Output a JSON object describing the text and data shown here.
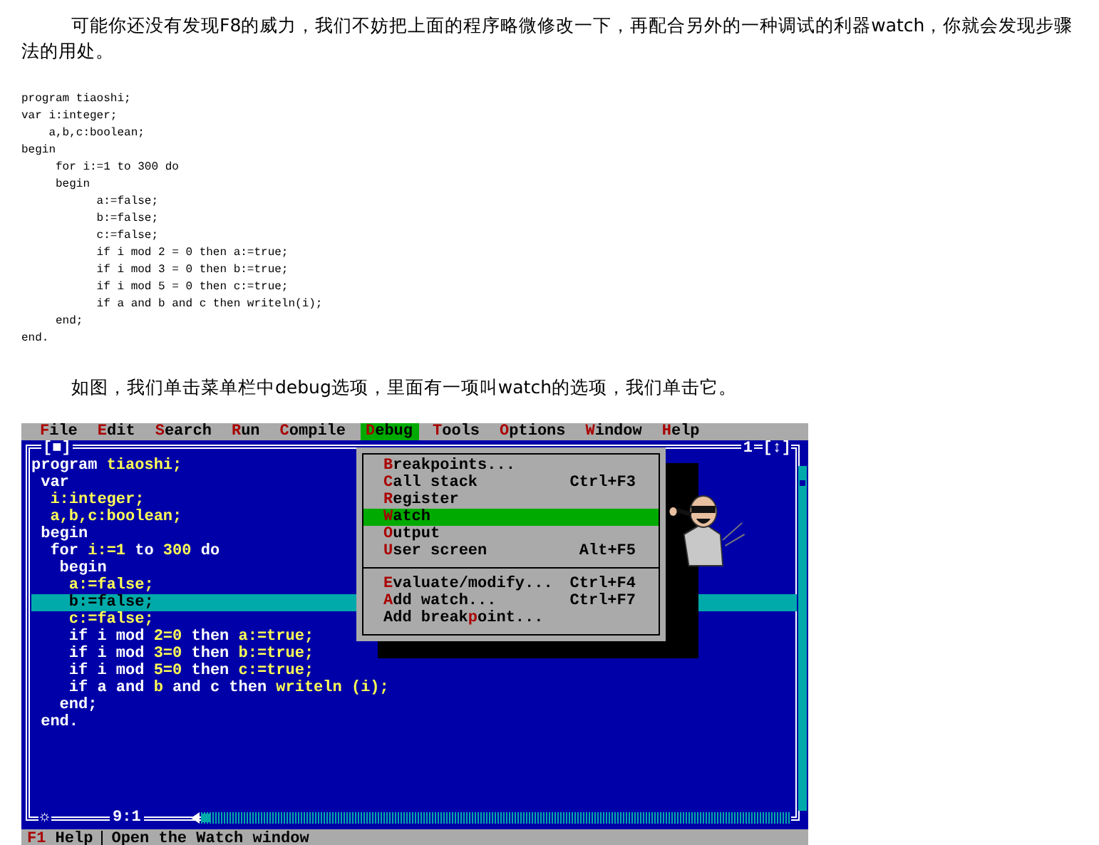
{
  "paragraphs": [
    "可能你还没有发现F8的威力，我们不妨把上面的程序略微修改一下，再配合另外的一种调试的利器watch，你就会发现步骤法的用处。"
  ],
  "code_listing": [
    "program tiaoshi;",
    "var i:integer;",
    "    a,b,c:boolean;",
    "begin",
    "     for i:=1 to 300 do",
    "     begin",
    "           a:=false;",
    "           b:=false;",
    "           c:=false;",
    "           if i mod 2 = 0 then a:=true;",
    "           if i mod 3 = 0 then b:=true;",
    "           if i mod 5 = 0 then c:=true;",
    "           if a and b and c then writeln(i);",
    "     end;",
    "end."
  ],
  "paragraph_2": "如图，我们单击菜单栏中debug选项，里面有一项叫watch的选项，我们单击它。",
  "ide": {
    "menu_bar": [
      {
        "hotkey": "F",
        "rest": "ile",
        "selected": false
      },
      {
        "hotkey": "E",
        "rest": "dit",
        "selected": false
      },
      {
        "hotkey": "S",
        "rest": "earch",
        "selected": false
      },
      {
        "hotkey": "R",
        "rest": "un",
        "selected": false
      },
      {
        "hotkey": "C",
        "rest": "ompile",
        "selected": false
      },
      {
        "hotkey": "D",
        "rest": "ebug",
        "selected": true
      },
      {
        "hotkey": "T",
        "rest": "ools",
        "selected": false
      },
      {
        "hotkey": "O",
        "rest": "ptions",
        "selected": false
      },
      {
        "hotkey": "W",
        "rest": "indow",
        "selected": false
      },
      {
        "hotkey": "H",
        "rest": "elp",
        "selected": false
      }
    ],
    "editor": {
      "close_box": "[■]",
      "window_number": "1",
      "zoom_box": "[↕]",
      "resize_glyph": "☼",
      "cursor_position": "9:1",
      "lines": [
        {
          "selected": false,
          "segments": [
            {
              "kind": "keyword",
              "text": "program"
            },
            {
              "kind": "text",
              "text": " tiaoshi;"
            }
          ]
        },
        {
          "selected": false,
          "segments": [
            {
              "kind": "keyword",
              "text": " var"
            }
          ]
        },
        {
          "selected": false,
          "segments": [
            {
              "kind": "text",
              "text": "  i:integer;"
            }
          ]
        },
        {
          "selected": false,
          "segments": [
            {
              "kind": "text",
              "text": "  a,b,c:boolean;"
            }
          ]
        },
        {
          "selected": false,
          "segments": [
            {
              "kind": "keyword",
              "text": " begin"
            }
          ]
        },
        {
          "selected": false,
          "segments": [
            {
              "kind": "keyword",
              "text": "  for"
            },
            {
              "kind": "text",
              "text": " i:=1 "
            },
            {
              "kind": "keyword",
              "text": "to"
            },
            {
              "kind": "text",
              "text": " 300 "
            },
            {
              "kind": "keyword",
              "text": "do"
            }
          ]
        },
        {
          "selected": false,
          "segments": [
            {
              "kind": "keyword",
              "text": "   begin"
            }
          ]
        },
        {
          "selected": false,
          "segments": [
            {
              "kind": "text",
              "text": "    a:=false;"
            }
          ]
        },
        {
          "selected": true,
          "segments": [
            {
              "kind": "text",
              "text": "    b:=false;"
            }
          ]
        },
        {
          "selected": false,
          "segments": [
            {
              "kind": "text",
              "text": "    c:=false;"
            }
          ]
        },
        {
          "selected": false,
          "segments": [
            {
              "kind": "keyword",
              "text": "    if i mod "
            },
            {
              "kind": "text",
              "text": "2=0"
            },
            {
              "kind": "keyword",
              "text": " then "
            },
            {
              "kind": "text",
              "text": "a:=true;"
            }
          ]
        },
        {
          "selected": false,
          "segments": [
            {
              "kind": "keyword",
              "text": "    if i mod "
            },
            {
              "kind": "text",
              "text": "3=0"
            },
            {
              "kind": "keyword",
              "text": " then "
            },
            {
              "kind": "text",
              "text": "b:=true;"
            }
          ]
        },
        {
          "selected": false,
          "segments": [
            {
              "kind": "keyword",
              "text": "    if i mod "
            },
            {
              "kind": "text",
              "text": "5=0"
            },
            {
              "kind": "keyword",
              "text": " then "
            },
            {
              "kind": "text",
              "text": "c:=true;"
            }
          ]
        },
        {
          "selected": false,
          "segments": [
            {
              "kind": "keyword",
              "text": "    if a and "
            },
            {
              "kind": "text",
              "text": "b"
            },
            {
              "kind": "keyword",
              "text": " and c then "
            },
            {
              "kind": "text",
              "text": "writeln (i);"
            }
          ]
        },
        {
          "selected": false,
          "segments": [
            {
              "kind": "keyword",
              "text": "   end;"
            }
          ]
        },
        {
          "selected": false,
          "segments": [
            {
              "kind": "keyword",
              "text": " end."
            }
          ]
        }
      ]
    },
    "debug_menu": [
      [
        {
          "hotkey": "B",
          "after": "reakpoints...",
          "selected": false
        },
        {
          "hotkey": "C",
          "after": "all stack",
          "shortcut": "Ctrl+F3",
          "selected": false
        },
        {
          "hotkey": "R",
          "after": "egister",
          "selected": false
        },
        {
          "hotkey": "W",
          "after": "atch",
          "selected": true
        },
        {
          "hotkey": "O",
          "after": "utput",
          "selected": false
        },
        {
          "hotkey": "U",
          "after": "ser screen",
          "shortcut": "Alt+F5",
          "selected": false
        }
      ],
      [
        {
          "hotkey": "E",
          "after": "valuate/modify...",
          "shortcut": "Ctrl+F4",
          "selected": false
        },
        {
          "hotkey": "A",
          "after": "dd watch...",
          "shortcut": "Ctrl+F7",
          "selected": false
        },
        {
          "before": "Add break",
          "hotkey": "p",
          "after": "oint...",
          "selected": false
        }
      ]
    ],
    "status_bar": {
      "key": "F1",
      "key_label": "Help",
      "message": "Open the Watch window"
    }
  }
}
